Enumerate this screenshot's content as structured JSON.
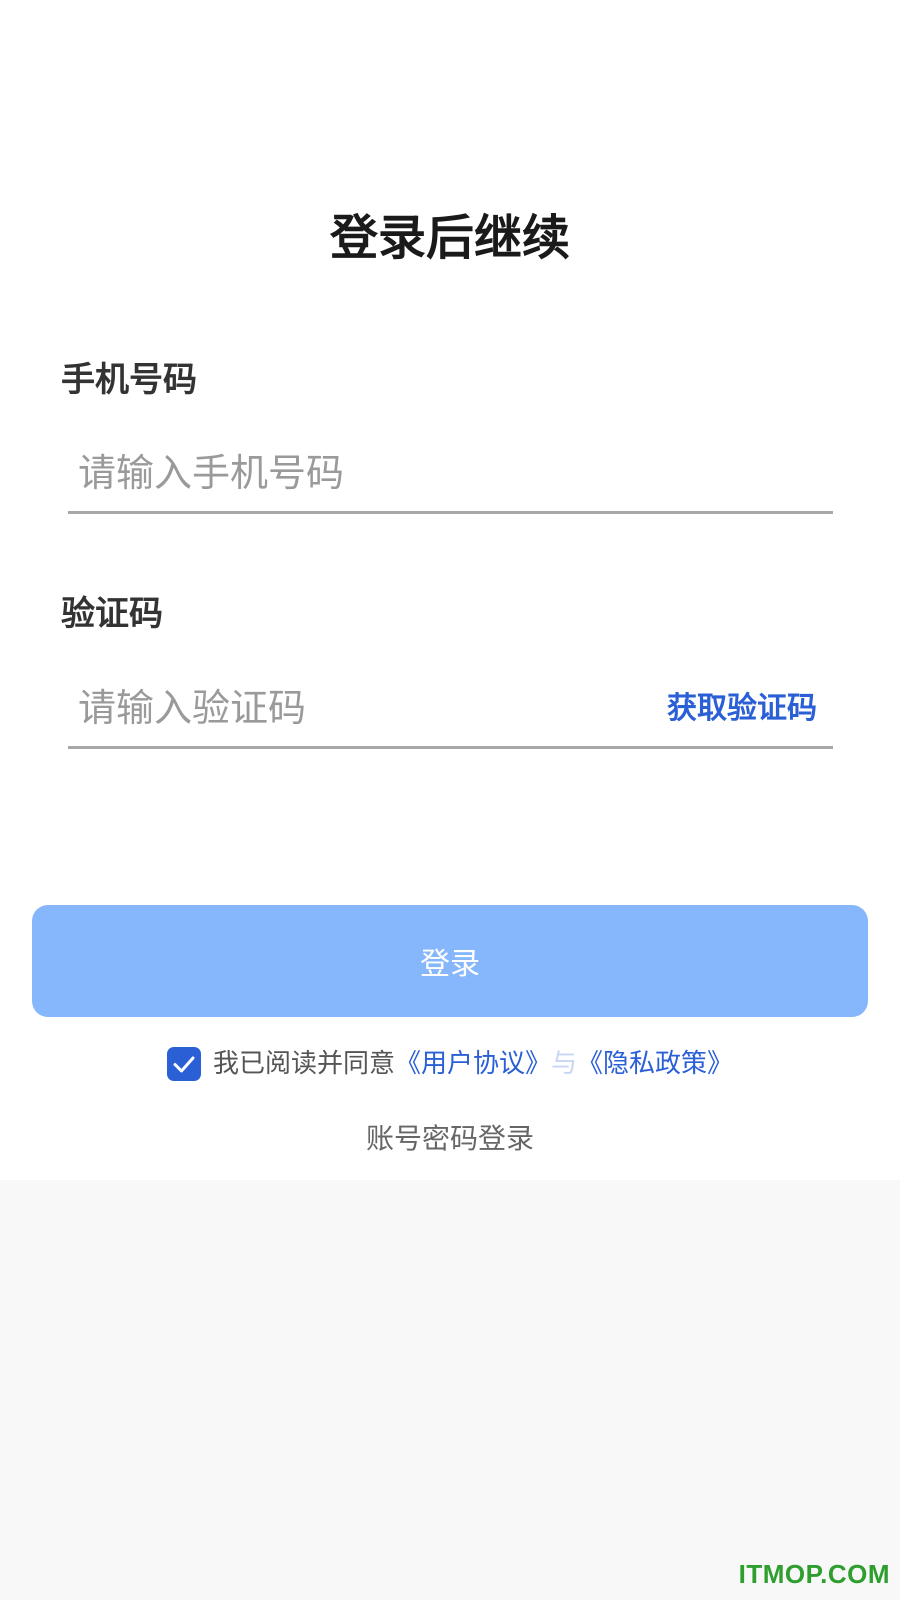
{
  "page": {
    "title": "登录后继续"
  },
  "phone": {
    "label": "手机号码",
    "placeholder": "请输入手机号码",
    "value": ""
  },
  "code": {
    "label": "验证码",
    "placeholder": "请输入验证码",
    "value": "",
    "get_code_label": "获取验证码"
  },
  "login_button": {
    "label": "登录",
    "color": "#86b6fc"
  },
  "agreement": {
    "checked": true,
    "prefix": "我已阅读并同意",
    "user_agreement": "《用户协议》",
    "conjunction": "与",
    "privacy_policy": "《隐私政策》",
    "accent_color": "#2a5fd6"
  },
  "alt_login": {
    "label": "账号密码登录"
  },
  "watermark": {
    "text": "ITMOP.COM"
  }
}
